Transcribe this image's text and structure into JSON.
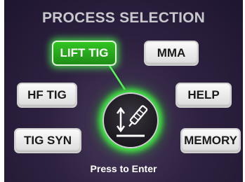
{
  "screen": {
    "title": "PROCESS SELECTION",
    "press_label": "Press to Enter"
  },
  "buttons": {
    "lift_tig": "LIFT TIG",
    "mma": "MMA",
    "hf_tig": "HF TIG",
    "help": "HELP",
    "tig_syn": "TIG SYN",
    "memory": "MEMORY"
  },
  "selected_process": "LIFT TIG",
  "icons": {
    "knob": "torch-icon"
  },
  "colors": {
    "active_green": "#2ab81e",
    "glow_green": "#50ff50",
    "background": "#2e2240"
  }
}
